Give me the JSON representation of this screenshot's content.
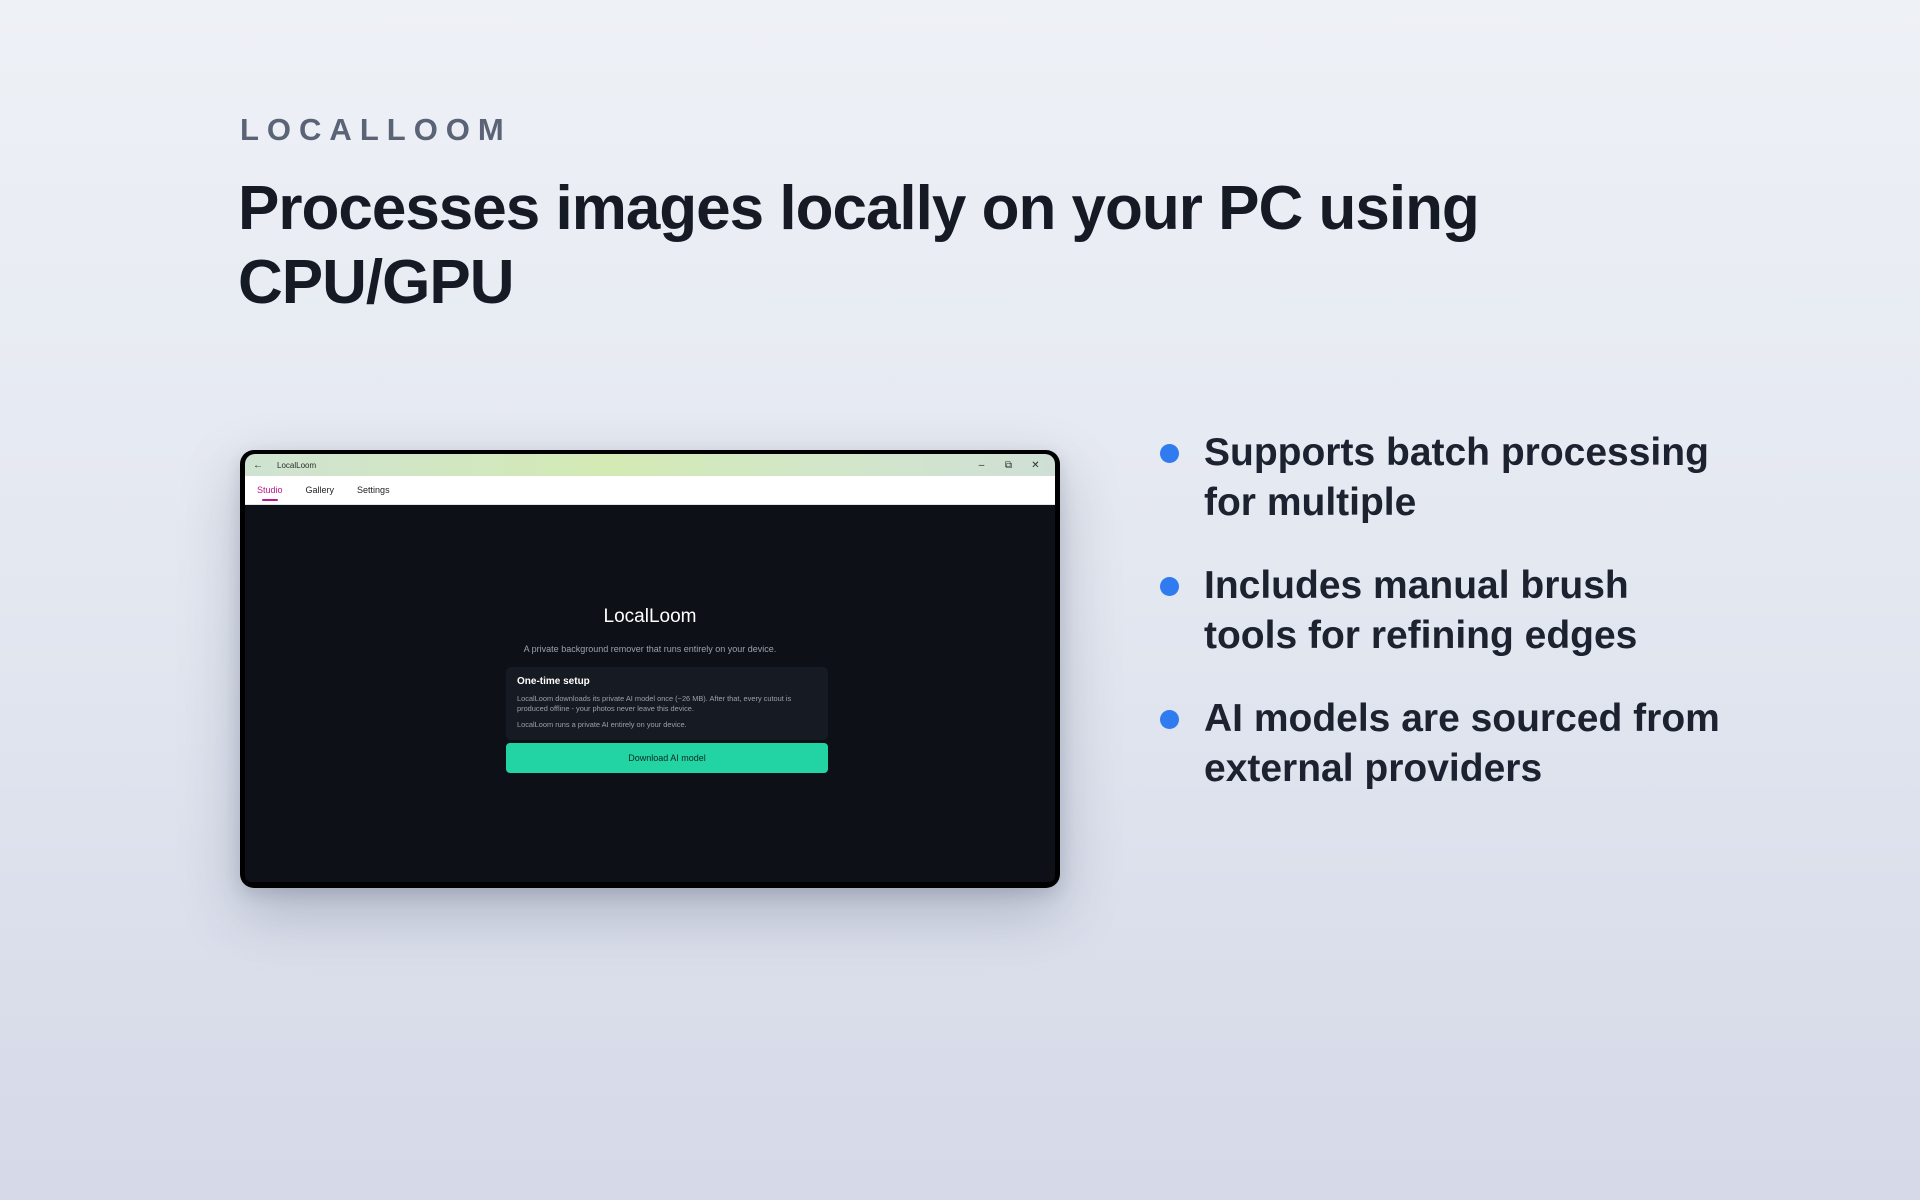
{
  "brand": "LOCALLOOM",
  "headline": "Processes images locally on your PC using CPU/GPU",
  "colors": {
    "accent_tab": "#c0168d",
    "download_button": "#22d3a4",
    "bullet_dot": "#2f7bef",
    "app_background": "#0d1016"
  },
  "app": {
    "window_title": "LocalLoom",
    "back_icon": "←",
    "controls": {
      "minimize": "–",
      "maximize": "⧉",
      "close": "✕"
    },
    "tabs": [
      {
        "label": "Studio",
        "active": true
      },
      {
        "label": "Gallery",
        "active": false
      },
      {
        "label": "Settings",
        "active": false
      }
    ],
    "name": "LocalLoom",
    "tagline": "A private background remover that runs entirely on your device.",
    "setup": {
      "title": "One-time setup",
      "text": "LocalLoom downloads its private AI model once (~26 MB). After that, every cutout is produced offline - your photos never leave this device.",
      "note": "LocalLoom runs a private AI entirely on your device."
    },
    "download_button": "Download AI model"
  },
  "bullets": [
    "Supports batch processing for multiple",
    "Includes manual brush tools for refining edges",
    "AI models are sourced from external providers"
  ]
}
